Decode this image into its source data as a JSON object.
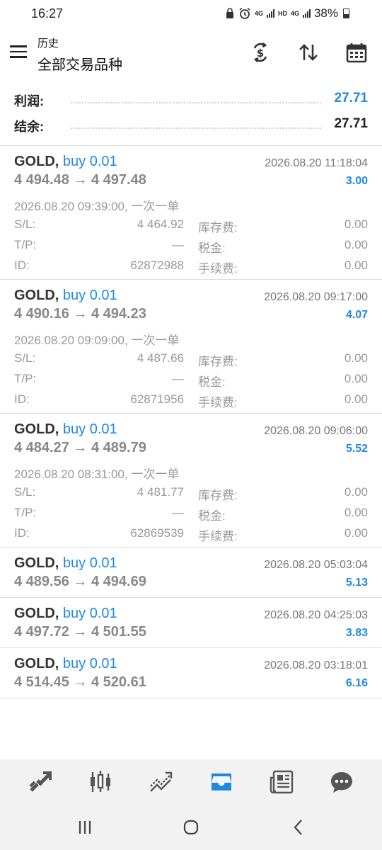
{
  "status": {
    "time": "16:27",
    "net_small_1": "4G",
    "net_small_2": "HD",
    "net_small_3": "4G",
    "battery": "38%"
  },
  "header": {
    "subtitle": "历史",
    "title": "全部交易品种"
  },
  "summary": {
    "profit_label": "利润:",
    "profit_value": "27.71",
    "balance_label": "结余:",
    "balance_value": "27.71"
  },
  "trades": [
    {
      "symbol": "GOLD,",
      "side": "buy 0.01",
      "prices": "4 494.48 → 4 497.48",
      "close_time": "2026.08.20 11:18:04",
      "profit": "3.00",
      "open_info": "2026.08.20 09:39:00, 一次一单",
      "sl_label": "S/L:",
      "sl": "4 464.92",
      "tp_label": "T/P:",
      "tp": "—",
      "id_label": "ID:",
      "id": "62872988",
      "swap_label": "库存费:",
      "swap": "0.00",
      "tax_label": "税金:",
      "tax": "0.00",
      "fee_label": "手续费:",
      "fee": "0.00"
    },
    {
      "symbol": "GOLD,",
      "side": "buy 0.01",
      "prices": "4 490.16 → 4 494.23",
      "close_time": "2026.08.20 09:17:00",
      "profit": "4.07",
      "open_info": "2026.08.20 09:09:00, 一次一单",
      "sl_label": "S/L:",
      "sl": "4 487.66",
      "tp_label": "T/P:",
      "tp": "—",
      "id_label": "ID:",
      "id": "62871956",
      "swap_label": "库存费:",
      "swap": "0.00",
      "tax_label": "税金:",
      "tax": "0.00",
      "fee_label": "手续费:",
      "fee": "0.00"
    },
    {
      "symbol": "GOLD,",
      "side": "buy 0.01",
      "prices": "4 484.27 → 4 489.79",
      "close_time": "2026.08.20 09:06:00",
      "profit": "5.52",
      "open_info": "2026.08.20 08:31:00, 一次一单",
      "sl_label": "S/L:",
      "sl": "4 481.77",
      "tp_label": "T/P:",
      "tp": "—",
      "id_label": "ID:",
      "id": "62869539",
      "swap_label": "库存费:",
      "swap": "0.00",
      "tax_label": "税金:",
      "tax": "0.00",
      "fee_label": "手续费:",
      "fee": "0.00"
    },
    {
      "symbol": "GOLD,",
      "side": "buy 0.01",
      "prices": "4 489.56 → 4 494.69",
      "close_time": "2026.08.20 05:03:04",
      "profit": "5.13"
    },
    {
      "symbol": "GOLD,",
      "side": "buy 0.01",
      "prices": "4 497.72 → 4 501.55",
      "close_time": "2026.08.20 04:25:03",
      "profit": "3.83"
    },
    {
      "symbol": "GOLD,",
      "side": "buy 0.01",
      "prices": "4 514.45 → 4 520.61",
      "close_time": "2026.08.20 03:18:01",
      "profit": "6.16"
    }
  ],
  "bottom_nav": {
    "items": [
      "quotes-icon",
      "chart-icon",
      "trade-icon",
      "history-icon",
      "news-icon",
      "chat-icon"
    ],
    "active": "history-icon",
    "active_color": "#1e88e5"
  },
  "colors": {
    "accent": "#1e88e5",
    "muted": "#999999"
  }
}
